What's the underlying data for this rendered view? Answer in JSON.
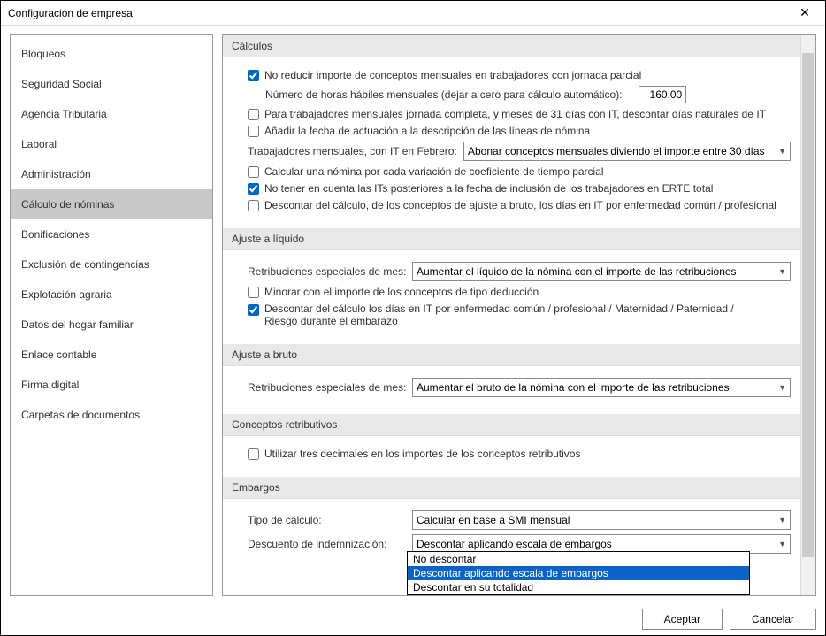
{
  "window": {
    "title": "Configuración de empresa"
  },
  "sidebar": {
    "items": [
      {
        "label": "Bloqueos"
      },
      {
        "label": "Seguridad Social"
      },
      {
        "label": "Agencia Tributaria"
      },
      {
        "label": "Laboral"
      },
      {
        "label": "Administración"
      },
      {
        "label": "Cálculo de nóminas"
      },
      {
        "label": "Bonificaciones"
      },
      {
        "label": "Exclusión de contingencias"
      },
      {
        "label": "Explotación agraria"
      },
      {
        "label": "Datos del hogar familiar"
      },
      {
        "label": "Enlace contable"
      },
      {
        "label": "Firma digital"
      },
      {
        "label": "Carpetas de documentos"
      }
    ],
    "selected_index": 5
  },
  "sections": {
    "calculos": {
      "title": "Cálculos",
      "no_reducir": {
        "checked": true,
        "label": "No reducir importe de conceptos mensuales en trabajadores con jornada parcial"
      },
      "horas_habiles": {
        "label": "Número de horas hábiles mensuales (dejar a cero para cálculo automático):",
        "value": "160,00"
      },
      "trabajadores_31": {
        "checked": false,
        "label": "Para trabajadores mensuales jornada completa, y meses de 31 días con IT, descontar días naturales de IT"
      },
      "anadir_fecha": {
        "checked": false,
        "label": "Añadir la fecha de actuación a la descripción de las líneas de nómina"
      },
      "it_febrero": {
        "label": "Trabajadores mensuales, con IT en Febrero:",
        "selected": "Abonar conceptos mensuales diviendo el importe entre 30 días"
      },
      "calcular_variacion": {
        "checked": false,
        "label": "Calcular una nómina por cada variación de coeficiente de tiempo parcial"
      },
      "no_tener_its": {
        "checked": true,
        "label": "No tener en cuenta las ITs posteriores a la fecha de inclusión de los trabajadores en ERTE total"
      },
      "descontar_ajuste": {
        "checked": false,
        "label": "Descontar del cálculo, de los conceptos de ajuste a bruto, los días en IT por enfermedad común / profesional"
      }
    },
    "ajuste_liquido": {
      "title": "Ajuste a líquido",
      "retribuciones": {
        "label": "Retribuciones especiales de mes:",
        "selected": "Aumentar el líquido de la nómina con el importe de las retribuciones"
      },
      "minorar": {
        "checked": false,
        "label": "Minorar con el importe de los conceptos de tipo deducción"
      },
      "descontar_it": {
        "checked": true,
        "label": "Descontar del cálculo los días en IT por enfermedad común / profesional / Maternidad / Paternidad / Riesgo durante el embarazo"
      }
    },
    "ajuste_bruto": {
      "title": "Ajuste a bruto",
      "retribuciones": {
        "label": "Retribuciones especiales de mes:",
        "selected": "Aumentar el bruto de la nómina con el importe de las retribuciones"
      }
    },
    "conceptos": {
      "title": "Conceptos retributivos",
      "tres_decimales": {
        "checked": false,
        "label": "Utilizar tres decimales en los importes de los conceptos retributivos"
      }
    },
    "embargos": {
      "title": "Embargos",
      "tipo_calculo": {
        "label": "Tipo de cálculo:",
        "selected": "Calcular en base a SMI mensual"
      },
      "descuento": {
        "label": "Descuento de indemnización:",
        "selected": "Descontar aplicando escala de embargos",
        "options": [
          "No descontar",
          "Descontar aplicando escala de embargos",
          "Descontar en su totalidad"
        ],
        "highlighted_index": 1
      }
    }
  },
  "footer": {
    "aceptar": "Aceptar",
    "cancelar": "Cancelar"
  }
}
